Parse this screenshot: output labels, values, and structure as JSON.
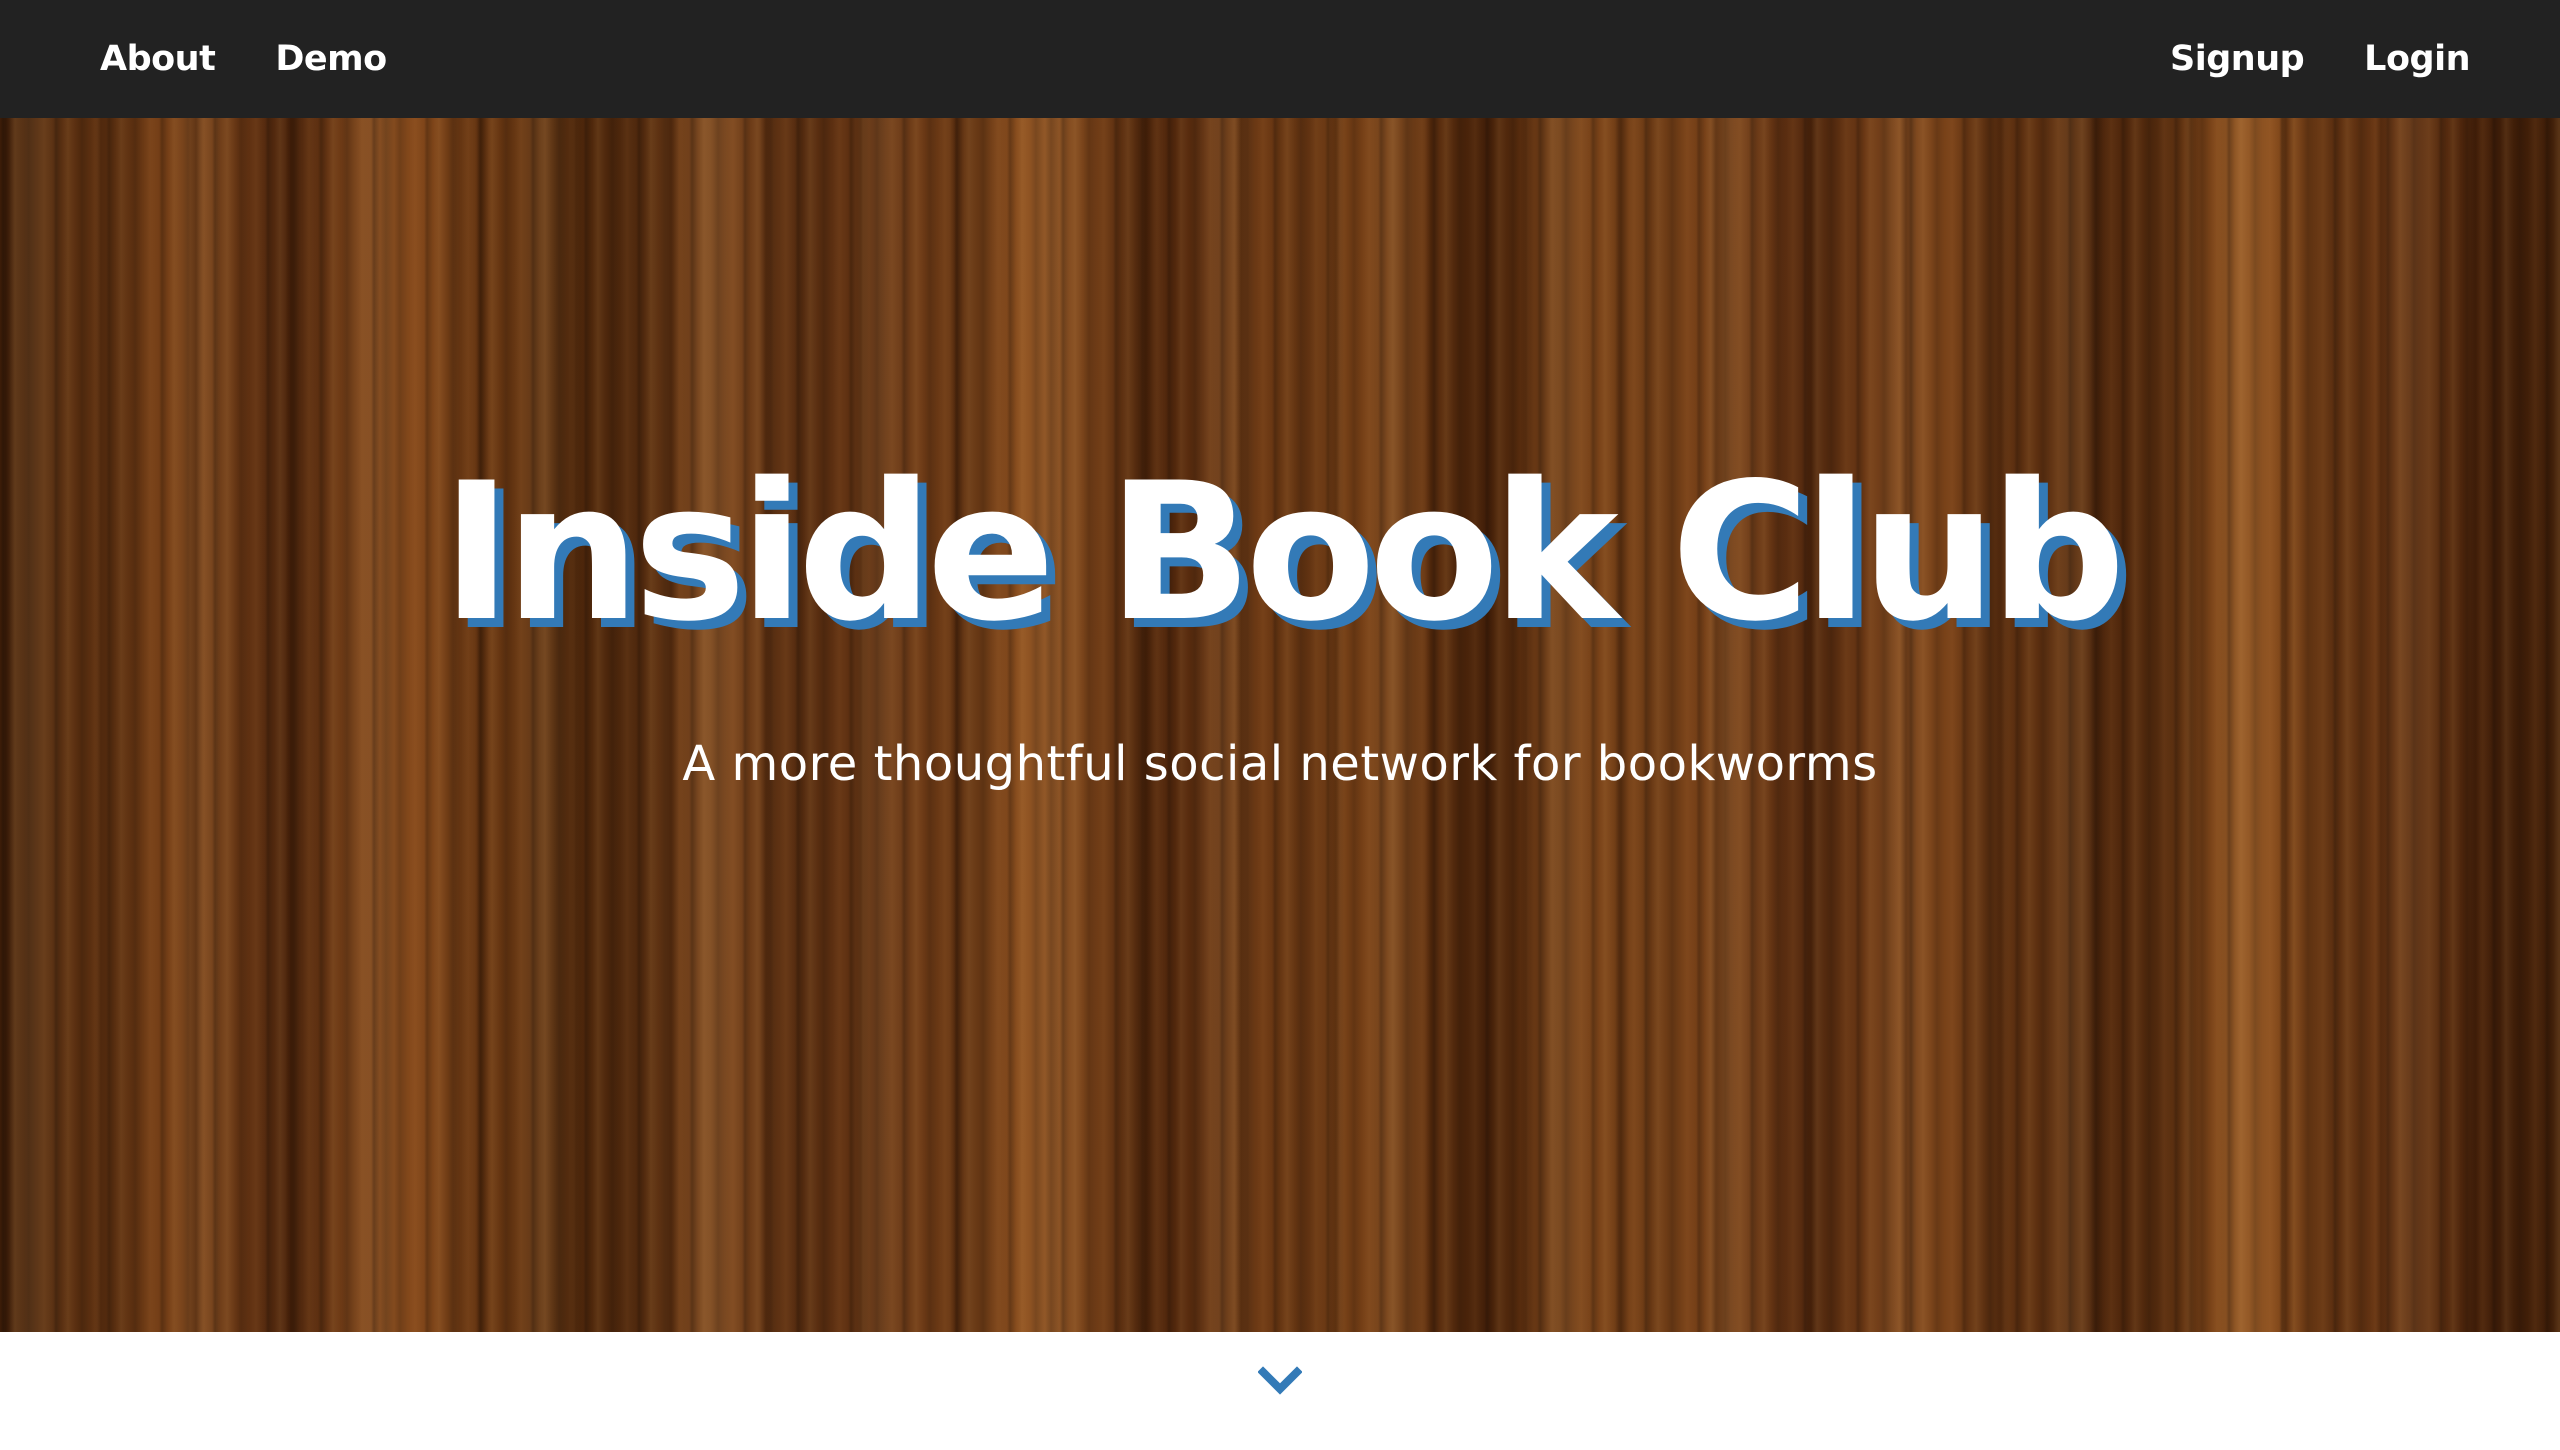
{
  "nav": {
    "left": [
      {
        "label": "About"
      },
      {
        "label": "Demo"
      }
    ],
    "right": [
      {
        "label": "Signup"
      },
      {
        "label": "Login"
      }
    ]
  },
  "hero": {
    "title": "Inside Book Club",
    "subtitle": "A more thoughtful social network for bookworms"
  },
  "scroll": {
    "icon": "chevron-down-icon"
  },
  "colors": {
    "navbar_bg": "#222222",
    "title_shadow": "#337ab7",
    "chevron": "#337ab7",
    "text": "#ffffff"
  }
}
